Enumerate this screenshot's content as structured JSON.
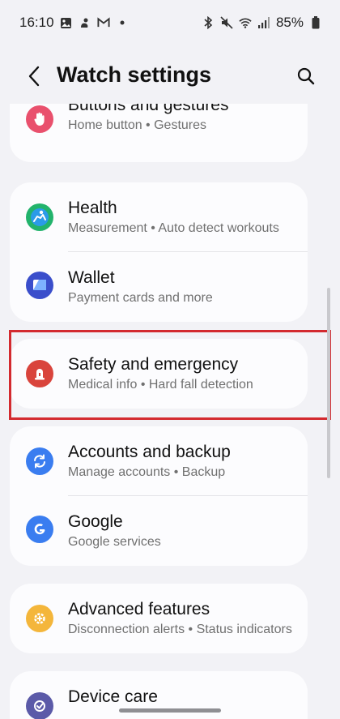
{
  "status_bar": {
    "time": "16:10",
    "battery": "85%",
    "left_icons": [
      "gallery-icon",
      "bixby-icon",
      "gmail-icon",
      "dot-icon"
    ],
    "right_icons": [
      "bluetooth-icon",
      "mute-icon",
      "wifi-icon",
      "signal-icon",
      "battery-icon"
    ]
  },
  "header": {
    "title": "Watch settings"
  },
  "sections": [
    {
      "items": [
        {
          "title": "Buttons and gestures",
          "subtitle": "Home button • Gestures",
          "icon": "hand-icon",
          "color": "#e9506d"
        }
      ]
    },
    {
      "items": [
        {
          "title": "Health",
          "subtitle": "Measurement • Auto detect workouts",
          "icon": "health-icon",
          "color": "#22b36c"
        },
        {
          "title": "Wallet",
          "subtitle": "Payment cards and more",
          "icon": "wallet-icon",
          "color": "#3a4ecb"
        }
      ]
    },
    {
      "items": [
        {
          "title": "Safety and emergency",
          "subtitle": "Medical info • Hard fall detection",
          "icon": "siren-icon",
          "color": "#d9443c"
        }
      ]
    },
    {
      "items": [
        {
          "title": "Accounts and backup",
          "subtitle": "Manage accounts • Backup",
          "icon": "sync-icon",
          "color": "#3a7df0"
        },
        {
          "title": "Google",
          "subtitle": "Google services",
          "icon": "google-icon",
          "color": "#3a7df0"
        }
      ]
    },
    {
      "items": [
        {
          "title": "Advanced features",
          "subtitle": "Disconnection alerts • Status indicators",
          "icon": "gear-plus-icon",
          "color": "#f4b63b"
        }
      ]
    },
    {
      "items": [
        {
          "title": "Device care",
          "icon": "device-care-icon",
          "color": "#5b5aa8"
        }
      ]
    }
  ]
}
